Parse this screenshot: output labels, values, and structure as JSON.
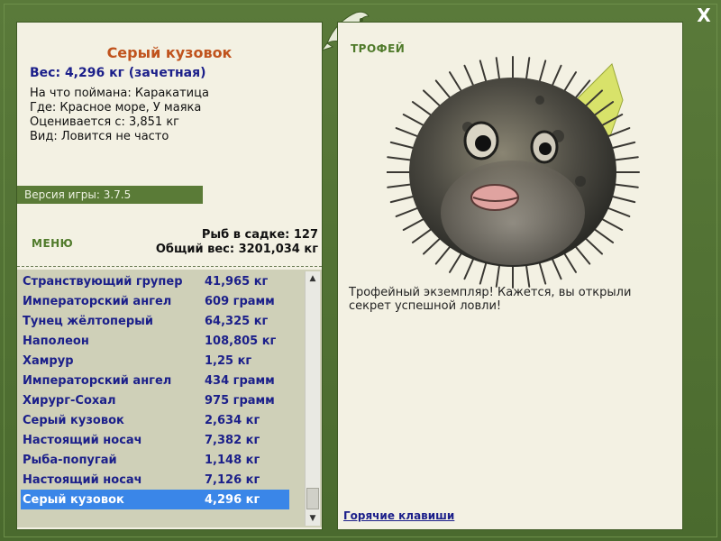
{
  "fish_info": {
    "title": "Серый кузовок",
    "weight": "Вес: 4,296 кг (зачетная)",
    "caught_on": "На что поймана: Каракатица",
    "where": "Где: Красное море, У маяка",
    "valued_from": "Оценивается с: 3,851 кг",
    "rarity": "Вид: Ловится не часто"
  },
  "version": "Версия игры: 3.7.5",
  "menu_label": "МЕНЮ",
  "stats": {
    "count": "Рыб в садке: 127",
    "total_weight": "Общий вес: 3201,034 кг"
  },
  "fish_list": [
    {
      "name": "Странствующий групер",
      "weight": "41,965 кг"
    },
    {
      "name": "Императорский ангел",
      "weight": "609 грамм"
    },
    {
      "name": "Тунец жёлтоперый",
      "weight": "64,325 кг"
    },
    {
      "name": "Наполеон",
      "weight": "108,805 кг"
    },
    {
      "name": "Хамрур",
      "weight": "1,25 кг"
    },
    {
      "name": "Императорский ангел",
      "weight": "434 грамм"
    },
    {
      "name": "Хирург-Сохал",
      "weight": "975 грамм"
    },
    {
      "name": "Серый кузовок",
      "weight": "2,634 кг"
    },
    {
      "name": "Настоящий носач",
      "weight": "7,382 кг"
    },
    {
      "name": "Рыба-попугай",
      "weight": "1,148 кг"
    },
    {
      "name": "Настоящий носач",
      "weight": "7,126 кг"
    },
    {
      "name": "Серый кузовок",
      "weight": "4,296 кг",
      "selected": true
    }
  ],
  "trophy": {
    "label": "ТРОФЕЙ",
    "text": "Трофейный экземпляр! Кажется, вы открыли секрет успешной ловли!"
  },
  "hotkeys_label": "Горячие клавиши",
  "close_label": "X",
  "icons": {
    "close": "close-icon",
    "scroll_up": "chevron-up-icon",
    "scroll_down": "chevron-down-icon",
    "logo": "fish-logo-icon"
  },
  "colors": {
    "frame": "#4f6e32",
    "panel": "#f3f1e3",
    "title": "#c0531d",
    "text_blue": "#1b1f8a",
    "selection": "#3a86e8"
  }
}
